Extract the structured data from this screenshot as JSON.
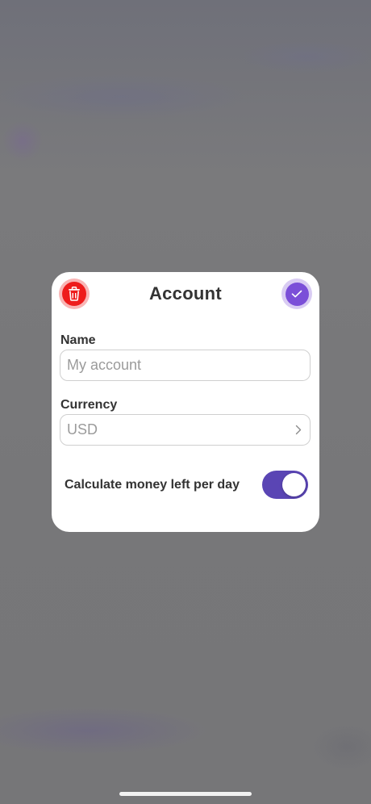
{
  "modal": {
    "title": "Account",
    "delete_icon": "trash-icon",
    "confirm_icon": "check-icon",
    "name": {
      "label": "Name",
      "placeholder": "My account",
      "value": ""
    },
    "currency": {
      "label": "Currency",
      "value": "USD",
      "icon": "chevron-right-icon"
    },
    "daily_toggle": {
      "label": "Calculate money left per day",
      "enabled": true
    }
  },
  "colors": {
    "overlay": "#777779",
    "delete_red": "#ee1c1c",
    "confirm_purple": "#7b4fd8",
    "toggle_on": "#5a45b4"
  }
}
